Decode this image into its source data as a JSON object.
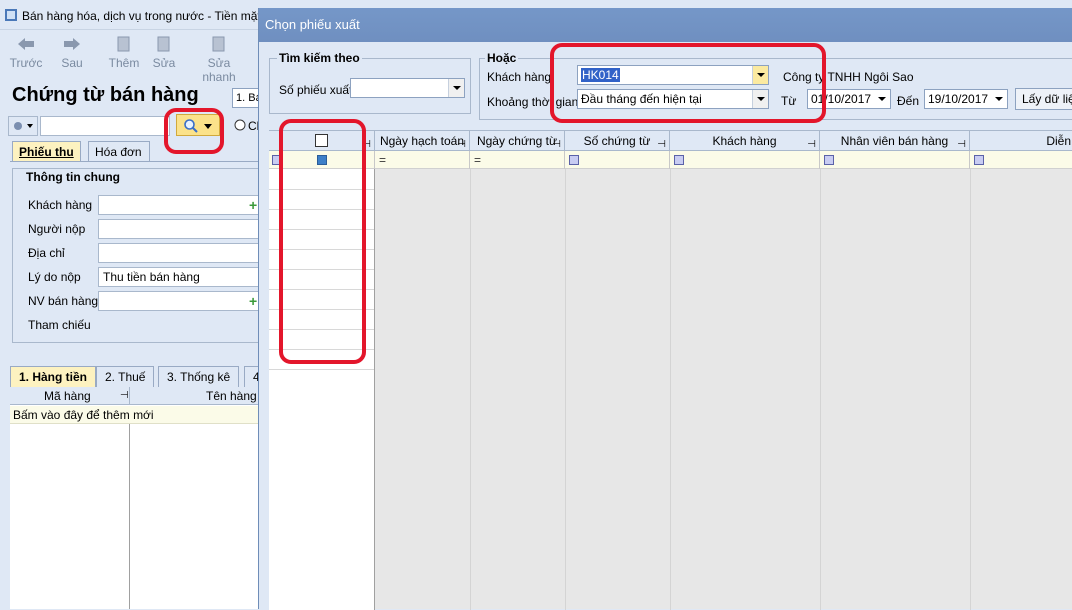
{
  "back_window": {
    "title": "Bán hàng hóa, dịch vụ trong nước - Tiền mặt",
    "toolbar": [
      {
        "label": "Trước",
        "icon": "arrow-left-icon"
      },
      {
        "label": "Sau",
        "icon": "arrow-right-icon"
      },
      {
        "label": "Thêm",
        "icon": "add-document-icon"
      },
      {
        "label": "Sửa",
        "icon": "edit-document-icon"
      },
      {
        "label": "Sửa nhanh",
        "icon": "quick-edit-icon"
      }
    ],
    "doc_title": "Chứng từ bán hàng",
    "doc_type_value": "1. Bá",
    "radio_label": "Ch",
    "tabs": [
      "Phiếu thu",
      "Hóa đơn"
    ],
    "info_legend": "Thông tin chung",
    "fields": [
      {
        "label": "Khách hàng",
        "value": ""
      },
      {
        "label": "Người nộp",
        "value": ""
      },
      {
        "label": "Địa chỉ",
        "value": ""
      },
      {
        "label": "Lý do nộp",
        "value": "Thu tiền bán hàng"
      },
      {
        "label": "NV bán hàng",
        "value": ""
      },
      {
        "label": "Tham chiếu",
        "value": ""
      }
    ],
    "bottom_tabs": [
      "1. Hàng tiền",
      "2. Thuế",
      "3. Thống kê",
      "4"
    ],
    "grid_cols": [
      "Mã hàng",
      "Tên hàng"
    ],
    "add_row_text": "Bấm vào đây để thêm mới"
  },
  "dialog": {
    "title": "Chọn phiếu xuất",
    "search_legend": "Tìm kiếm theo",
    "search_field_label": "Số phiếu xuất",
    "search_field_value": "",
    "or_legend": "Hoặc",
    "customer_label": "Khách hàng",
    "customer_value": "HK014",
    "customer_name": "Công ty TNHH Ngôi Sao",
    "period_label": "Khoảng thời gian",
    "period_value": "Đầu tháng đến hiện tại",
    "from_label": "Từ",
    "from_value": "01/10/2017",
    "to_label": "Đến",
    "to_value": "19/10/2017",
    "load_button": "Lấy dữ liệ",
    "columns": [
      "Ngày hạch toán",
      "Ngày chứng từ",
      "Số chứng từ",
      "Khách hàng",
      "Nhân viên bán hàng",
      "Diễn"
    ]
  },
  "colors": {
    "highlight_red": "#e3162b",
    "title_blue": "#7597c8"
  }
}
